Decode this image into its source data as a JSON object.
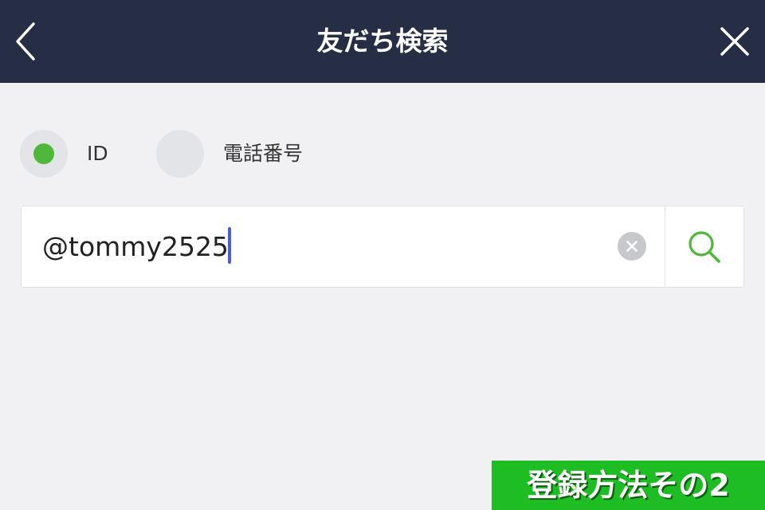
{
  "header": {
    "title": "友だち検索",
    "back_icon": "chevron-left-icon",
    "close_icon": "close-icon"
  },
  "search_type": {
    "options": [
      {
        "label": "ID",
        "selected": true
      },
      {
        "label": "電話番号",
        "selected": false
      }
    ]
  },
  "search": {
    "value": "@tommy2525",
    "clear_icon": "clear-icon",
    "search_icon": "search-icon"
  },
  "banner": {
    "text": "登録方法その2"
  },
  "colors": {
    "header_bg": "#262e45",
    "page_bg": "#f1f1f3",
    "accent_green": "#4fb83b",
    "banner_green": "#1fbd24",
    "caret": "#4a5fd6"
  }
}
